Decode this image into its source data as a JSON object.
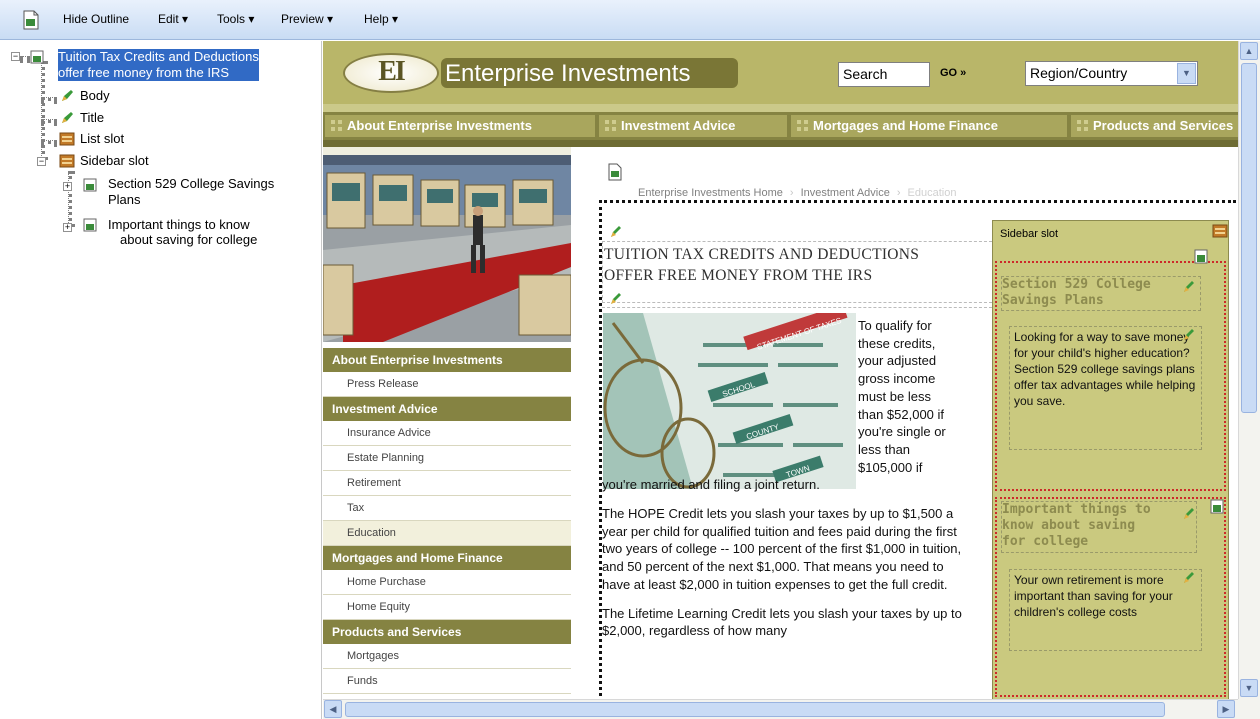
{
  "menubar": {
    "items": [
      "Hide Outline",
      "Edit ▾",
      "Tools ▾",
      "Preview ▾",
      "Help ▾"
    ]
  },
  "outline": {
    "root_label": "Tuition Tax Credits and Deductions offer free money from the IRS",
    "root_line1": "Tuition Tax Credits and Deductions",
    "root_line2": "offer free money from the IRS",
    "items": [
      {
        "label": "Body"
      },
      {
        "label": "Title"
      },
      {
        "label": "List slot"
      },
      {
        "label": "Sidebar slot"
      }
    ],
    "sidebar_children": [
      {
        "line1": "Section 529 College Savings",
        "line2": "Plans"
      },
      {
        "line1": "Important things to know",
        "line2": "about saving for college"
      }
    ]
  },
  "site": {
    "brand_mark": "EI",
    "brand_name": "Enterprise Investments",
    "search_value": "Search",
    "go_label": "GO »",
    "region_value": "Region/Country",
    "top_nav": [
      "About Enterprise Investments",
      "Investment Advice",
      "Mortgages and Home Finance",
      "Products and Services"
    ],
    "side_nav": [
      {
        "type": "head",
        "label": "About Enterprise Investments"
      },
      {
        "type": "item",
        "label": "Press Release"
      },
      {
        "type": "head",
        "label": "Investment Advice"
      },
      {
        "type": "item",
        "label": "Insurance Advice"
      },
      {
        "type": "item",
        "label": "Estate Planning"
      },
      {
        "type": "item",
        "label": "Retirement"
      },
      {
        "type": "item",
        "label": "Tax"
      },
      {
        "type": "item",
        "label": "Education",
        "active": true
      },
      {
        "type": "head",
        "label": "Mortgages and Home Finance"
      },
      {
        "type": "item",
        "label": "Home Purchase"
      },
      {
        "type": "item",
        "label": "Home Equity"
      },
      {
        "type": "head",
        "label": "Products and Services"
      },
      {
        "type": "item",
        "label": "Mortgages"
      },
      {
        "type": "item",
        "label": "Funds"
      }
    ]
  },
  "content": {
    "breadcrumb": [
      "Enterprise Investments Home",
      "Investment Advice",
      "Education"
    ],
    "headline_line1": "TUITION TAX CREDITS AND DEDUCTIONS",
    "headline_line2": "OFFER FREE MONEY FROM THE IRS",
    "float_lines": [
      "To qualify for",
      "these credits,",
      "your adjusted",
      "gross income",
      "must be less",
      "than $52,000 if",
      "you're single or",
      "less than",
      "$105,000 if"
    ],
    "para1_tail": "you're married and filing a joint return.",
    "para2": "The HOPE Credit lets you slash your taxes by up to $1,500 a year per child for qualified tuition and fees paid during the first two years of college -- 100 percent of the first $1,000 in tuition, and 50 percent of the next $1,000. That means you need to have at least $2,000 in tuition expenses to get the full credit.",
    "para3": "The Lifetime Learning Credit lets you slash your taxes by up to $2,000, regardless of how many",
    "photo_labels": [
      "STATEMENT OF TAXES",
      "SCHOOL",
      "COUNTY",
      "TOWN"
    ]
  },
  "sidebar": {
    "label": "Sidebar slot",
    "block1_title_line1": "Section 529 College",
    "block1_title_line2": "Savings Plans",
    "block1_text": "Looking for a way to save money for your child's higher education? Section 529 college savings plans offer tax advantages while helping you save.",
    "block2_title_line1": "Important things to",
    "block2_title_line2": "know about saving",
    "block2_title_line3": "for college",
    "block2_text": "Your own retirement is more important than saving for your children's college costs"
  },
  "colors": {
    "olive_header": "#b9b669",
    "olive_dark": "#858342",
    "sidebar_fill": "#cac97f",
    "selection": "#316ac5"
  },
  "icons": [
    "app-icon",
    "edit-pencil-icon",
    "page-icon",
    "slot-icon",
    "expand-icon",
    "collapse-icon"
  ]
}
